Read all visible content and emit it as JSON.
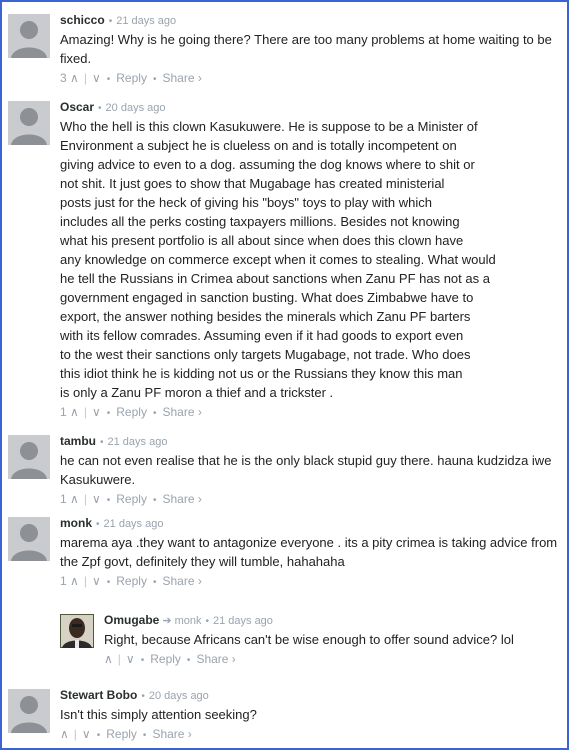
{
  "comments": [
    {
      "author": "schicco",
      "time": "21 days ago",
      "lines": [
        "Amazing! Why is he going there? There are too many problems at home waiting to be",
        "fixed."
      ],
      "votes": "3",
      "reply_label": "Reply",
      "share_label": "Share ›"
    },
    {
      "author": "Oscar",
      "time": "20 days ago",
      "lines": [
        "Who the hell is this clown Kasukuwere. He is suppose to be a Minister of",
        "Environment a subject he is clueless on and is totally incompetent on",
        "giving advice to even to a dog. assuming the dog knows where to shit or",
        "not shit. It just goes to show that Mugabage has created ministerial",
        "posts just for the heck of giving his \"boys\" toys to play with which",
        "includes all the perks costing taxpayers millions. Besides not knowing",
        "what his present portfolio is all about since when does this clown have",
        "any knowledge on commerce except when it comes to stealing. What would",
        "he tell the Russians in Crimea about sanctions when Zanu PF has not as a",
        "government engaged in sanction busting. What does Zimbabwe have to",
        "export, the answer nothing besides the minerals which Zanu PF barters",
        "with its fellow comrades. Assuming even if it had goods to export even",
        "to the west their sanctions only targets Mugabage, not trade. Who does",
        "this idiot think he is kidding not us or the Russians they know this man",
        "is only a Zanu PF moron a thief and a trickster ."
      ],
      "votes": "1",
      "reply_label": "Reply",
      "share_label": "Share ›"
    },
    {
      "author": "tambu",
      "time": "21 days ago",
      "lines": [
        "he can not even realise that he is the only black stupid guy there. hauna kudzidza iwe",
        "Kasukuwere."
      ],
      "votes": "1",
      "reply_label": "Reply",
      "share_label": "Share ›"
    },
    {
      "author": "monk",
      "time": "21 days ago",
      "lines": [
        "marema aya .they want to antagonize everyone . its a pity crimea is taking advice from",
        "the Zpf govt, definitely they will tumble, hahahaha"
      ],
      "votes": "1",
      "reply_label": "Reply",
      "share_label": "Share ›"
    },
    {
      "author": "Omugabe",
      "parent": "monk",
      "time": "21 days ago",
      "lines": [
        "Right, because Africans can't be wise enough to offer sound advice? lol"
      ],
      "votes": "",
      "reply_label": "Reply",
      "share_label": "Share ›"
    },
    {
      "author": "Stewart Bobo",
      "time": "20 days ago",
      "lines": [
        "Isn't this simply attention seeking?"
      ],
      "votes": "",
      "reply_label": "Reply",
      "share_label": "Share ›"
    }
  ],
  "colors": {
    "border": "#3b63d6",
    "meta": "#9aa3ad",
    "avatar": "#c9cbce"
  },
  "icons": {
    "up": "∧",
    "down": "∨",
    "reply_arrow": "➔"
  }
}
